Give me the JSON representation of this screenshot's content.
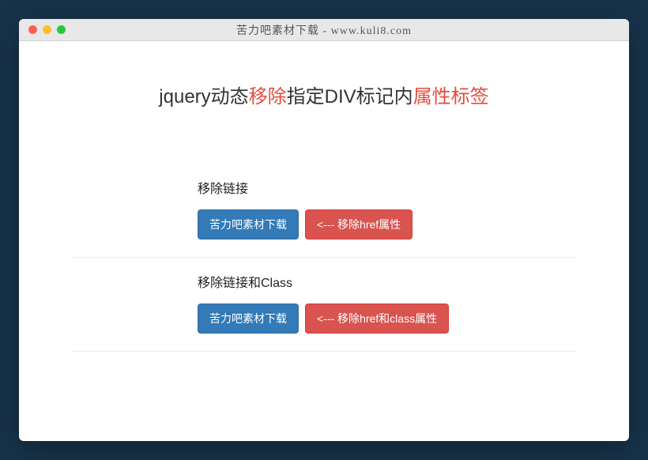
{
  "window": {
    "title": "苦力吧素材下载 - www.kuli8.com"
  },
  "heading": {
    "part1": "jquery动态",
    "hl1": "移除",
    "part2": "指定DIV标记内",
    "hl2": "属性标签"
  },
  "sections": [
    {
      "title": "移除链接",
      "primary_label": "苦力吧素材下载",
      "action_label": "<--- 移除href属性"
    },
    {
      "title": "移除链接和Class",
      "primary_label": "苦力吧素材下载",
      "action_label": "<--- 移除href和class属性"
    }
  ]
}
